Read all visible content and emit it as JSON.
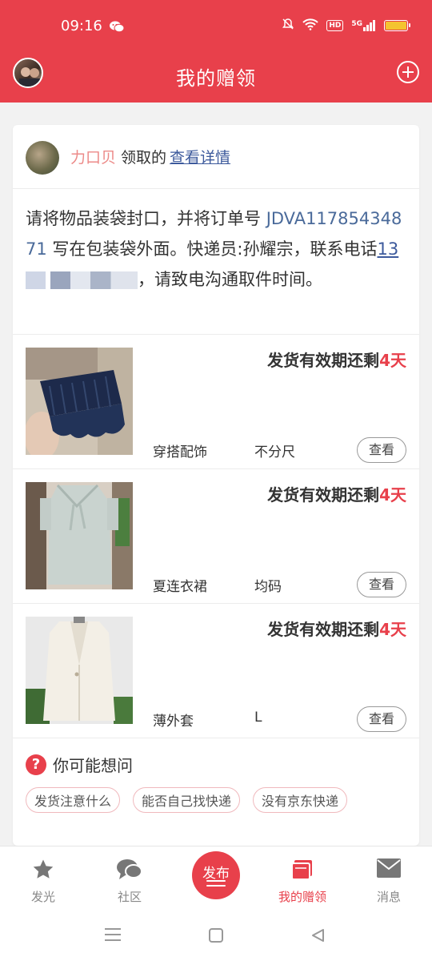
{
  "status_bar": {
    "time": "09:16",
    "hd_label": "HD",
    "network_label": "5G",
    "icons": [
      "wechat-icon",
      "bell-off-icon",
      "wifi-icon",
      "hd-icon",
      "signal-icon",
      "battery-icon"
    ],
    "battery_color": "#f4c430"
  },
  "app_bar": {
    "title": "我的赠领",
    "icons": [
      "user-avatar",
      "add-circle-icon"
    ],
    "background": "#e8404b"
  },
  "card": {
    "giver_name": "力口贝",
    "claim_text": "领取的",
    "detail_link": "查看详情",
    "notice": {
      "part1": "请将物品装袋封口，并将订单号 ",
      "order_no": "JDVA11785434871",
      "part2": " 写在包装袋外面。快递员:孙耀宗，联系电话",
      "phone": "13",
      "part3": "，请致电沟通取件时间。"
    },
    "items": [
      {
        "deadline_prefix": "发货有效期还剩",
        "deadline_days": "4天",
        "category": "穿搭配饰",
        "size": "不分尺",
        "view_label": "查看"
      },
      {
        "deadline_prefix": "发货有效期还剩",
        "deadline_days": "4天",
        "category": "夏连衣裙",
        "size": "均码",
        "view_label": "查看"
      },
      {
        "deadline_prefix": "发货有效期还剩",
        "deadline_days": "4天",
        "category": "薄外套",
        "size": "L",
        "view_label": "查看"
      }
    ],
    "faq": {
      "icon_label": "?",
      "title": "你可能想问",
      "tags": [
        "发货注意什么",
        "能否自己找快递",
        "没有京东快递"
      ]
    }
  },
  "tab_bar": {
    "tabs": [
      {
        "label": "发光",
        "icon": "star-icon"
      },
      {
        "label": "社区",
        "icon": "chat-bubbles-icon"
      },
      {
        "label": "发布",
        "icon": "publish-icon"
      },
      {
        "label": "我的赠领",
        "icon": "gift-box-icon",
        "active": true
      },
      {
        "label": "消息",
        "icon": "mail-icon"
      }
    ],
    "active_color": "#e8404b"
  },
  "system_nav": {
    "icons": [
      "menu-icon",
      "home-icon",
      "back-icon"
    ]
  }
}
